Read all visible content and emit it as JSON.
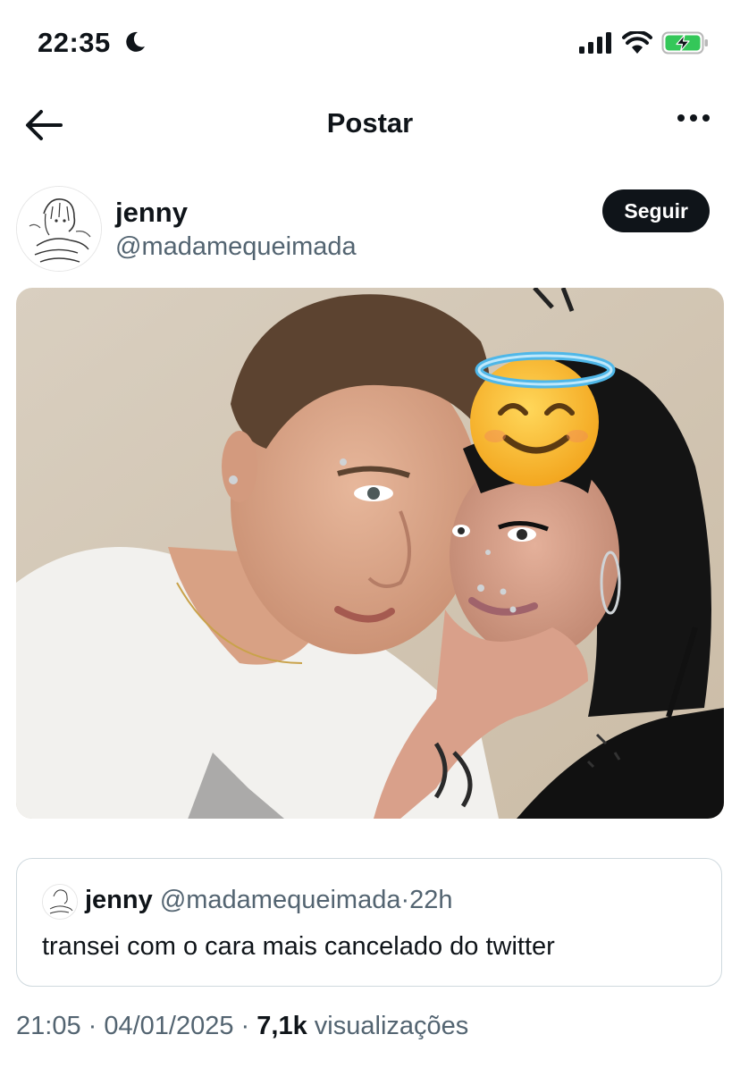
{
  "status_bar": {
    "time": "22:35",
    "moon_icon": "moon-icon",
    "signal_icon": "cellular-signal-icon",
    "wifi_icon": "wifi-icon",
    "battery_icon": "battery-charging-icon",
    "battery_color": "#34c759"
  },
  "nav": {
    "title": "Postar",
    "back_icon": "arrow-left-icon",
    "more_icon": "more-horizontal-icon"
  },
  "post": {
    "author_name": "jenny",
    "author_handle": "@madamequeimada",
    "follow_label": "Seguir",
    "photo_emoji": "😇",
    "quoted": {
      "name": "jenny",
      "handle": "@madamequeimada",
      "separator": "·",
      "time": "22h",
      "text": "transei com o cara mais cancelado do twitter"
    },
    "timestamp": "21:05 · 04/01/2025",
    "separator": "·",
    "views_count": "7,1k",
    "views_label": "visualizações"
  }
}
